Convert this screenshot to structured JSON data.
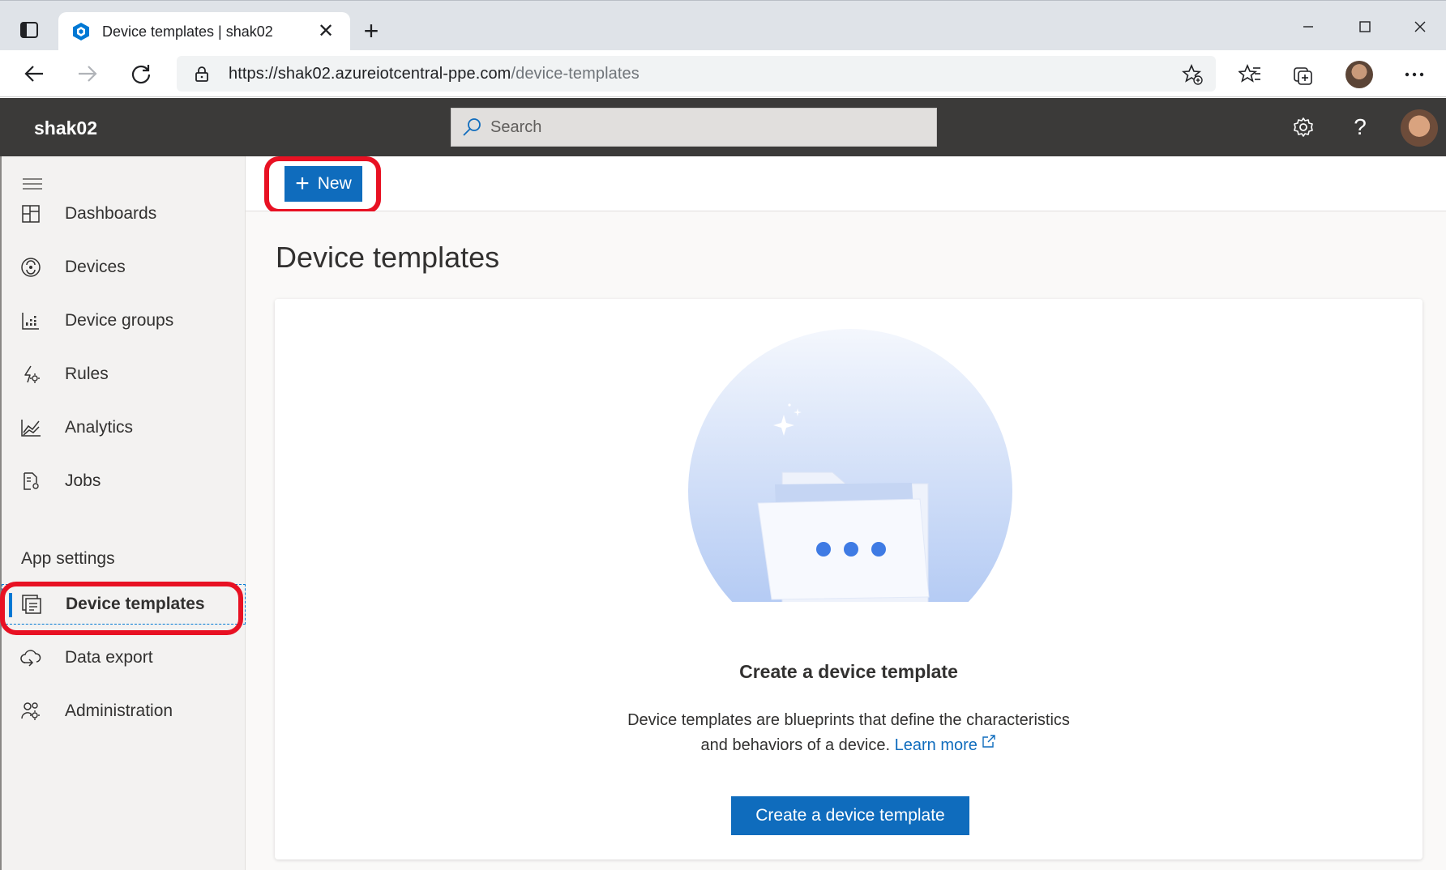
{
  "browser": {
    "tab_title": "Device templates | shak02",
    "url_base": "https://shak02.azureiotcentral-ppe.com",
    "url_path": "/device-templates"
  },
  "app": {
    "name": "shak02",
    "search_placeholder": "Search"
  },
  "sidebar": {
    "items": [
      {
        "label": "Dashboards",
        "icon": "dashboard-icon"
      },
      {
        "label": "Devices",
        "icon": "devices-icon"
      },
      {
        "label": "Device groups",
        "icon": "device-groups-icon"
      },
      {
        "label": "Rules",
        "icon": "rules-icon"
      },
      {
        "label": "Analytics",
        "icon": "analytics-icon"
      },
      {
        "label": "Jobs",
        "icon": "jobs-icon"
      }
    ],
    "section_label": "App settings",
    "settings_items": [
      {
        "label": "Device templates",
        "icon": "device-templates-icon",
        "active": true
      },
      {
        "label": "Data export",
        "icon": "data-export-icon"
      },
      {
        "label": "Administration",
        "icon": "administration-icon"
      }
    ]
  },
  "command_bar": {
    "new_label": "New"
  },
  "main": {
    "title": "Device templates",
    "empty_state": {
      "title": "Create a device template",
      "desc_line1": "Device templates are blueprints that define the characteristics",
      "desc_line2": "and behaviors of a device.",
      "learn_more": "Learn more",
      "button_label": "Create a device template"
    }
  },
  "colors": {
    "accent": "#0f6cbd",
    "header_bg": "#3b3a39",
    "highlight": "#e81123"
  }
}
